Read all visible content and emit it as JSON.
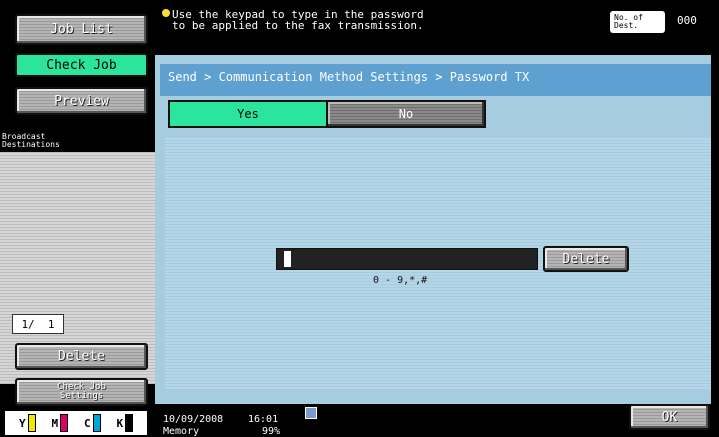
{
  "sidebar": {
    "job_list": "Job List",
    "check_job": "Check Job",
    "preview": "Preview",
    "broadcast_destinations": "Broadcast\nDestinations",
    "page_indicator": "1/  1",
    "delete": "Delete",
    "check_job_settings": "Check Job\nSettings",
    "toner": [
      "Y",
      "M",
      "C",
      "K"
    ],
    "toner_colors": [
      "#f1e800",
      "#d9006b",
      "#00a6d6",
      "#000000"
    ]
  },
  "header": {
    "message_line1": "Use the keypad to type in the password",
    "message_line2": "to be applied to the fax transmission.",
    "dest_label": "No. of\nDest.",
    "dest_count": "000"
  },
  "main": {
    "breadcrumb": "Send > Communication Method Settings > Password TX",
    "yes": "Yes",
    "no": "No",
    "delete": "Delete",
    "hint": "0 - 9,*,#"
  },
  "footer": {
    "date": "10/09/2008",
    "time": "16:01",
    "memory_label": "Memory",
    "memory_value": "99%",
    "ok": "OK"
  }
}
